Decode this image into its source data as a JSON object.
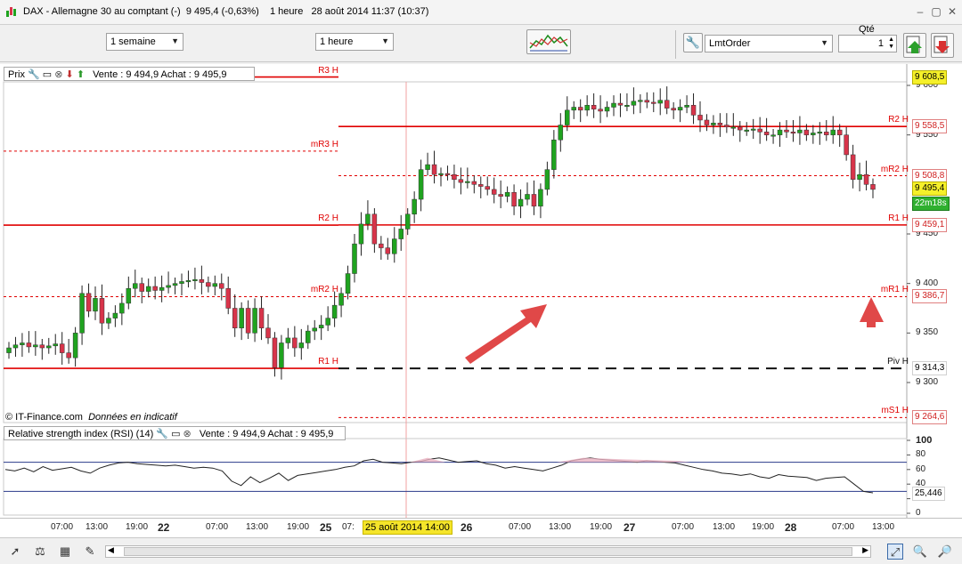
{
  "window": {
    "title": "DAX - Allemagne 30 au comptant (-)",
    "price_info": "9 495,4 (-0,63%)",
    "timeframe": "1 heure",
    "datetime": "28 août 2014 11:37 (10:37)",
    "controls": {
      "minimize": "–",
      "restore": "▢",
      "close": "✕"
    }
  },
  "toolbar": {
    "period_select": "1 semaine",
    "interval_select": "1 heure",
    "order_type_select": "LmtOrder",
    "qty_label": "Qté",
    "qty_value": "1"
  },
  "price_panel": {
    "label": "Prix",
    "quote": "Vente : 9 494,9 Achat : 9 495,9",
    "watermark": "© IT-Finance.com",
    "watermark_note": "Données en indicatif"
  },
  "rsi_panel": {
    "label": "Relative strength index (RSI) (14)",
    "quote": "Vente : 9 494,9 Achat : 9 495,9",
    "current_value": "25,446",
    "axis_ticks": [
      "100",
      "80",
      "60",
      "40",
      "20",
      "0"
    ]
  },
  "levels": [
    {
      "name": "R3 H",
      "side": "left",
      "value": 9608.5,
      "style": "solid"
    },
    {
      "name": "mR3 H",
      "side": "left",
      "value": 9533.7,
      "style": "dotted"
    },
    {
      "name": "R2 H",
      "side": "left",
      "value": 9458.9,
      "style": "solid"
    },
    {
      "name": "mR2 H",
      "side": "left",
      "value": 9386.7,
      "style": "dotted"
    },
    {
      "name": "R1 H",
      "side": "left",
      "value": 9314.3,
      "style": "solid"
    },
    {
      "name": "R2 H",
      "side": "right",
      "value": 9558.5,
      "style": "solid"
    },
    {
      "name": "mR2 H",
      "side": "right",
      "value": 9508.8,
      "style": "dotted"
    },
    {
      "name": "R1 H",
      "side": "right",
      "value": 9459.1,
      "style": "solid"
    },
    {
      "name": "mR1 H",
      "side": "right",
      "value": 9386.7,
      "style": "dotted"
    },
    {
      "name": "Piv H",
      "side": "right",
      "value": 9314.3,
      "style": "dashed"
    },
    {
      "name": "mS1 H",
      "side": "right",
      "value": 9264.6,
      "style": "dotted"
    }
  ],
  "price_axis": {
    "ticks": [
      "9 600",
      "9 550",
      "9 450",
      "9 400",
      "9 350",
      "9 300"
    ],
    "boxes": [
      {
        "text": "9 608,5",
        "kind": "yellow"
      },
      {
        "text": "9 558,5",
        "kind": "red"
      },
      {
        "text": "9 508,8",
        "kind": "red"
      },
      {
        "text": "9 495,4",
        "kind": "yellow"
      },
      {
        "text": "22m18s",
        "kind": "green"
      },
      {
        "text": "9 459,1",
        "kind": "red"
      },
      {
        "text": "9 386,7",
        "kind": "red"
      },
      {
        "text": "9 314,3",
        "kind": "plain"
      },
      {
        "text": "9 264,6",
        "kind": "red"
      }
    ]
  },
  "x_axis": {
    "labels": [
      "07:00",
      "13:00",
      "19:00",
      "22",
      "07:00",
      "13:00",
      "19:00",
      "25",
      "07:",
      "26",
      "07:00",
      "13:00",
      "19:00",
      "27",
      "07:00",
      "13:00",
      "19:00",
      "28",
      "07:00",
      "13:00"
    ],
    "crosshair_label": "25 août 2014 14:00"
  },
  "colors": {
    "up": "#1fa31f",
    "down": "#d8344a",
    "level": "#e00000",
    "arrow": "#e04848"
  },
  "bottom_icons": [
    "cursor-icon",
    "zoom-scale-icon",
    "compare-icon",
    "draw-icon",
    "settings-icon",
    "save-icon",
    "crosshair-icon",
    "layout-icon",
    "fit-icon",
    "zoom-in-icon",
    "zoom-out-icon"
  ]
}
